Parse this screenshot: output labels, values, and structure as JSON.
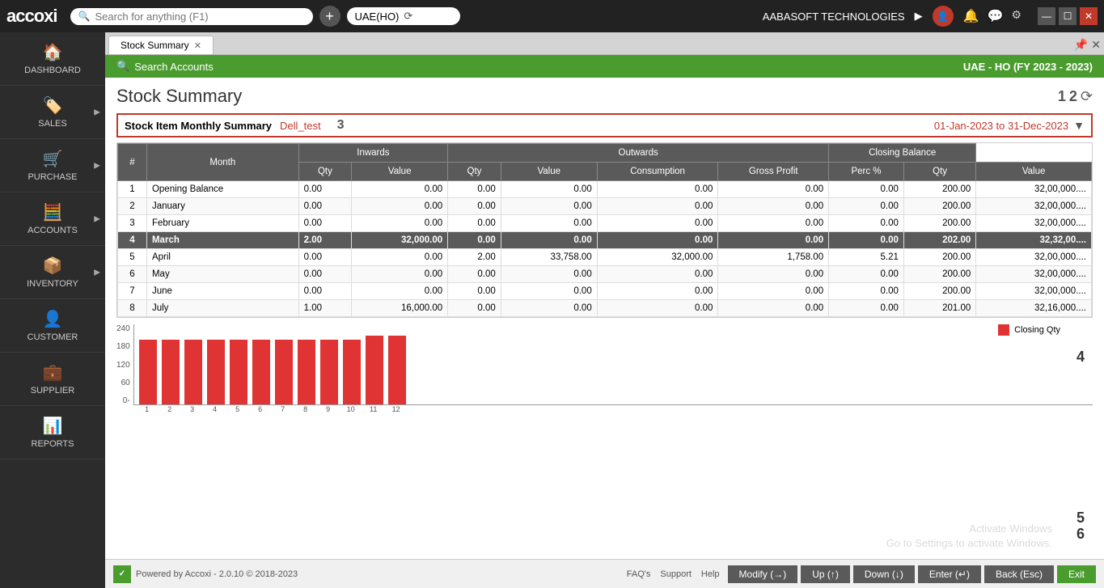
{
  "topbar": {
    "logo": "accoxi",
    "search_placeholder": "Search for anything (F1)",
    "company": "UAE(HO)",
    "company_name": "AABASOFT TECHNOLOGIES",
    "add_icon": "+",
    "refresh_icon": "⟳",
    "bell_icon": "🔔",
    "chat_icon": "💬",
    "settings_icon": "⚙",
    "min_icon": "—",
    "max_icon": "☐",
    "close_icon": "✕"
  },
  "sidebar": {
    "items": [
      {
        "id": "dashboard",
        "label": "DASHBOARD",
        "icon": "🏠"
      },
      {
        "id": "sales",
        "label": "SALES",
        "icon": "🏷️"
      },
      {
        "id": "purchase",
        "label": "PURCHASE",
        "icon": "🛒"
      },
      {
        "id": "accounts",
        "label": "ACCOUNTS",
        "icon": "🧮"
      },
      {
        "id": "inventory",
        "label": "INVENTORY",
        "icon": "📦"
      },
      {
        "id": "customer",
        "label": "CUSTOMER",
        "icon": "👤"
      },
      {
        "id": "supplier",
        "label": "SUPPLIER",
        "icon": "💼"
      },
      {
        "id": "reports",
        "label": "REPORTS",
        "icon": "📊"
      }
    ]
  },
  "tab": {
    "label": "Stock Summary",
    "pin_icon": "📌",
    "close_icon": "✕"
  },
  "green_bar": {
    "search_icon": "🔍",
    "search_label": "Search Accounts",
    "company_info": "UAE - HO (FY 2023 - 2023)"
  },
  "page": {
    "title": "Stock Summary",
    "num1": "1",
    "num2": "2"
  },
  "summary": {
    "title": "Stock Item Monthly Summary",
    "item": "Dell_test",
    "date_range": "01-Jan-2023 to 31-Dec-2023",
    "filter_icon": "▼",
    "label3": "3"
  },
  "table": {
    "group_headers": [
      {
        "label": "Inwards",
        "colspan": 2
      },
      {
        "label": "Outwards",
        "colspan": 4
      },
      {
        "label": "Closing Balance",
        "colspan": 2
      }
    ],
    "columns": [
      "#",
      "Month",
      "Qty",
      "Value",
      "Qty",
      "Value",
      "Consumption",
      "Gross Profit",
      "Perc %",
      "Qty",
      "Value"
    ],
    "rows": [
      {
        "num": "1",
        "month": "Opening Balance",
        "in_qty": "0.00",
        "in_val": "0.00",
        "out_qty": "0.00",
        "out_val": "0.00",
        "consumption": "0.00",
        "gross_profit": "0.00",
        "perc": "0.00",
        "close_qty": "200.00",
        "close_val": "32,00,000....",
        "highlighted": false
      },
      {
        "num": "2",
        "month": "January",
        "in_qty": "0.00",
        "in_val": "0.00",
        "out_qty": "0.00",
        "out_val": "0.00",
        "consumption": "0.00",
        "gross_profit": "0.00",
        "perc": "0.00",
        "close_qty": "200.00",
        "close_val": "32,00,000....",
        "highlighted": false
      },
      {
        "num": "3",
        "month": "February",
        "in_qty": "0.00",
        "in_val": "0.00",
        "out_qty": "0.00",
        "out_val": "0.00",
        "consumption": "0.00",
        "gross_profit": "0.00",
        "perc": "0.00",
        "close_qty": "200.00",
        "close_val": "32,00,000....",
        "highlighted": false
      },
      {
        "num": "4",
        "month": "March",
        "in_qty": "2.00",
        "in_val": "32,000.00",
        "out_qty": "0.00",
        "out_val": "0.00",
        "consumption": "0.00",
        "gross_profit": "0.00",
        "perc": "0.00",
        "close_qty": "202.00",
        "close_val": "32,32,00....",
        "highlighted": true
      },
      {
        "num": "5",
        "month": "April",
        "in_qty": "0.00",
        "in_val": "0.00",
        "out_qty": "2.00",
        "out_val": "33,758.00",
        "consumption": "32,000.00",
        "gross_profit": "1,758.00",
        "perc": "5.21",
        "close_qty": "200.00",
        "close_val": "32,00,000....",
        "highlighted": false
      },
      {
        "num": "6",
        "month": "May",
        "in_qty": "0.00",
        "in_val": "0.00",
        "out_qty": "0.00",
        "out_val": "0.00",
        "consumption": "0.00",
        "gross_profit": "0.00",
        "perc": "0.00",
        "close_qty": "200.00",
        "close_val": "32,00,000....",
        "highlighted": false
      },
      {
        "num": "7",
        "month": "June",
        "in_qty": "0.00",
        "in_val": "0.00",
        "out_qty": "0.00",
        "out_val": "0.00",
        "consumption": "0.00",
        "gross_profit": "0.00",
        "perc": "0.00",
        "close_qty": "200.00",
        "close_val": "32,00,000....",
        "highlighted": false
      },
      {
        "num": "8",
        "month": "July",
        "in_qty": "1.00",
        "in_val": "16,000.00",
        "out_qty": "0.00",
        "out_val": "0.00",
        "consumption": "0.00",
        "gross_profit": "0.00",
        "perc": "0.00",
        "close_qty": "201.00",
        "close_val": "32,16,000....",
        "highlighted": false
      }
    ]
  },
  "chart": {
    "y_labels": [
      "240",
      "180",
      "120",
      "60",
      "0"
    ],
    "bars": [
      {
        "label": "1",
        "height": 80
      },
      {
        "label": "2",
        "height": 80
      },
      {
        "label": "3",
        "height": 80
      },
      {
        "label": "4",
        "height": 80
      },
      {
        "label": "5",
        "height": 80
      },
      {
        "label": "6",
        "height": 80
      },
      {
        "label": "7",
        "height": 80
      },
      {
        "label": "8",
        "height": 80
      },
      {
        "label": "9",
        "height": 80
      },
      {
        "label": "10",
        "height": 80
      },
      {
        "label": "11",
        "height": 85
      },
      {
        "label": "12",
        "height": 85
      }
    ],
    "legend_label": "Closing Qty",
    "num4": "4",
    "num5": "5",
    "num6": "6",
    "watermark": "Activate Windows\nGo to Settings to activate Windows."
  },
  "bottom": {
    "powered_by": "Powered by Accoxi - 2.0.10 © 2018-2023",
    "faq": "FAQ's",
    "support": "Support",
    "help": "Help",
    "buttons": [
      {
        "label": "Modify (→)",
        "type": "normal"
      },
      {
        "label": "Up (↑)",
        "type": "normal"
      },
      {
        "label": "Down (↓)",
        "type": "normal"
      },
      {
        "label": "Enter (↵)",
        "type": "normal"
      },
      {
        "label": "Back (Esc)",
        "type": "normal"
      },
      {
        "label": "Exit",
        "type": "green"
      }
    ]
  }
}
